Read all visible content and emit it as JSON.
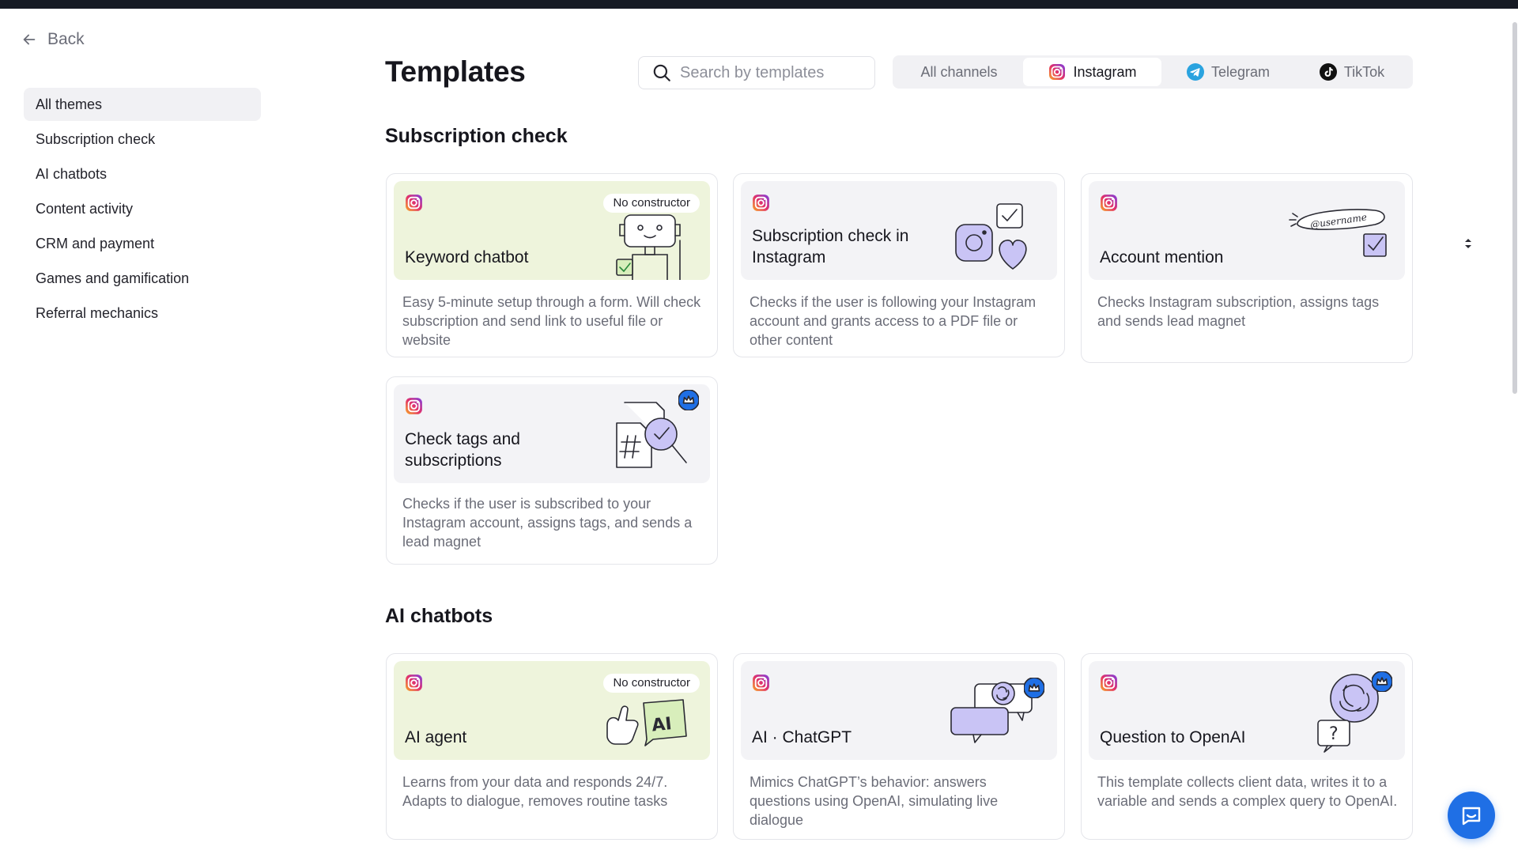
{
  "nav": {
    "back_label": "Back"
  },
  "sidebar": {
    "items": [
      {
        "label": "All themes"
      },
      {
        "label": "Subscription check"
      },
      {
        "label": "AI chatbots"
      },
      {
        "label": "Content activity"
      },
      {
        "label": "CRM and payment"
      },
      {
        "label": "Games and gamification"
      },
      {
        "label": "Referral mechanics"
      }
    ],
    "active_index": 0
  },
  "header": {
    "title": "Templates",
    "search_placeholder": "Search by templates",
    "channels": [
      {
        "label": "All channels",
        "icon": "none"
      },
      {
        "label": "Instagram",
        "icon": "instagram-icon",
        "active": true
      },
      {
        "label": "Telegram",
        "icon": "telegram-icon"
      },
      {
        "label": "TikTok",
        "icon": "tiktok-icon"
      }
    ]
  },
  "sections": [
    {
      "title": "Subscription check",
      "cards": [
        {
          "title": "Keyword chatbot",
          "badge": "No constructor",
          "description": "Easy 5-minute setup through a form. Will check subscription and send link to useful file or website",
          "illustration": "robot-checkbox-icon"
        },
        {
          "title": "Subscription check in Instagram",
          "description": "Checks if the user is following your Instagram account and grants access to a PDF file or other content",
          "illustration": "instagram-heart-check-icon"
        },
        {
          "title": "Account mention",
          "description": "Checks Instagram subscription, assigns tags and sends lead magnet",
          "illustration": "username-mention-icon",
          "illustration_text": "@username"
        },
        {
          "title": "Check tags and subscriptions",
          "description": "Checks if the user is subscribed to your Instagram account, assigns tags, and sends a lead magnet",
          "illustration": "hashtag-magnifier-icon",
          "premium": true
        }
      ]
    },
    {
      "title": "AI chatbots",
      "cards": [
        {
          "title": "AI agent",
          "badge": "No constructor",
          "description": "Learns from your data and responds 24/7. Adapts to dialogue, removes routine tasks",
          "illustration": "ai-hand-icon",
          "illustration_text": "AI"
        },
        {
          "title": "AI · ChatGPT",
          "description": "Mimics ChatGPT’s behavior: answers questions using OpenAI, simulating live dialogue",
          "illustration": "chat-bubbles-openai-icon",
          "premium": true
        },
        {
          "title": "Question to OpenAI",
          "description": "This template collects client data, writes it to a variable and sends a complex query to OpenAI.",
          "illustration": "openai-question-icon",
          "premium": true
        }
      ]
    }
  ],
  "colors": {
    "accent_blue": "#1f6fe5",
    "green_card": "#eef4dc",
    "grey_card": "#f3f3f6",
    "illustration_purple": "#c9c4f5",
    "instagram_gradient": [
      "#f9a825",
      "#e1306c",
      "#7b3fe4"
    ]
  }
}
